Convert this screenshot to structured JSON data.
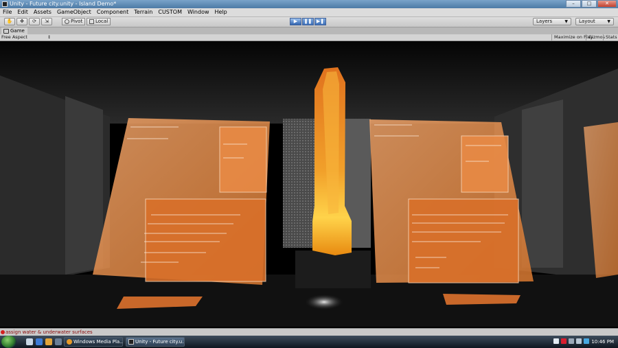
{
  "window": {
    "title": "Unity - Future city.unity - Island Demo*"
  },
  "menu": [
    "File",
    "Edit",
    "Assets",
    "GameObject",
    "Component",
    "Terrain",
    "CUSTOM",
    "Window",
    "Help"
  ],
  "toolbar": {
    "pivot_label": "Pivot",
    "local_label": "Local",
    "layers_label": "Layers",
    "layout_label": "Layout"
  },
  "game_view": {
    "tab_label": "Game",
    "aspect_label": "Free Aspect",
    "maximize_label": "Maximize on Play",
    "gizmos_label": "Gizmos",
    "stats_label": "Stats"
  },
  "status": {
    "message": "assign water & underwater surfaces"
  },
  "taskbar": {
    "items": [
      {
        "label": "Windows Media Pla..."
      },
      {
        "label": "Unity - Future city.u..."
      }
    ],
    "clock": "10:46 PM"
  },
  "colors": {
    "accent_orange": "#e07a2c",
    "play_blue": "#3b6fb9",
    "error_red": "#8a0a0a"
  }
}
